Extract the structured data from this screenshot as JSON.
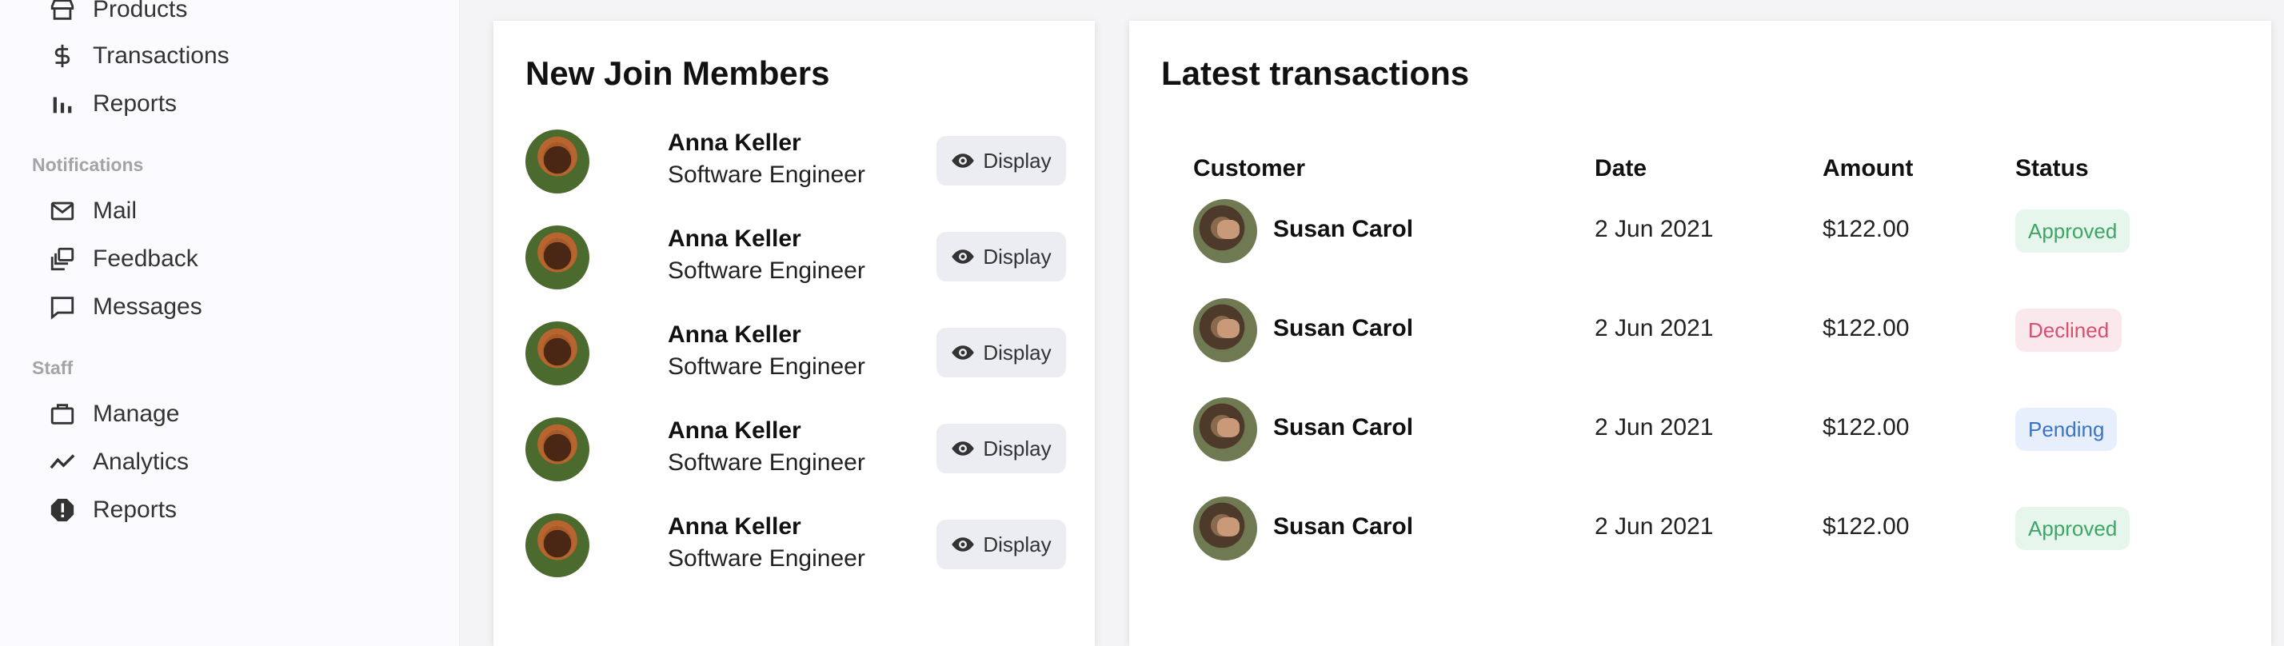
{
  "sidebar": {
    "items_top": [
      {
        "label": "Products",
        "icon": "store-icon"
      },
      {
        "label": "Transactions",
        "icon": "dollar-icon"
      },
      {
        "label": "Reports",
        "icon": "bar-chart-icon"
      }
    ],
    "notifications_title": "Notifications",
    "notifications_items": [
      {
        "label": "Mail",
        "icon": "mail-icon"
      },
      {
        "label": "Feedback",
        "icon": "feedback-icon"
      },
      {
        "label": "Messages",
        "icon": "message-icon"
      }
    ],
    "staff_title": "Staff",
    "staff_items": [
      {
        "label": "Manage",
        "icon": "briefcase-icon"
      },
      {
        "label": "Analytics",
        "icon": "trend-icon"
      },
      {
        "label": "Reports",
        "icon": "alert-icon"
      }
    ]
  },
  "members": {
    "title": "New Join Members",
    "button_label": "Display",
    "rows": [
      {
        "name": "Anna Keller",
        "role": "Software Engineer"
      },
      {
        "name": "Anna Keller",
        "role": "Software Engineer"
      },
      {
        "name": "Anna Keller",
        "role": "Software Engineer"
      },
      {
        "name": "Anna Keller",
        "role": "Software Engineer"
      },
      {
        "name": "Anna Keller",
        "role": "Software Engineer"
      }
    ]
  },
  "transactions": {
    "title": "Latest transactions",
    "columns": {
      "customer": "Customer",
      "date": "Date",
      "amount": "Amount",
      "status": "Status"
    },
    "rows": [
      {
        "customer": "Susan Carol",
        "date": "2 Jun 2021",
        "amount": "$122.00",
        "status": "Approved"
      },
      {
        "customer": "Susan Carol",
        "date": "2 Jun 2021",
        "amount": "$122.00",
        "status": "Declined"
      },
      {
        "customer": "Susan Carol",
        "date": "2 Jun 2021",
        "amount": "$122.00",
        "status": "Pending"
      },
      {
        "customer": "Susan Carol",
        "date": "2 Jun 2021",
        "amount": "$122.00",
        "status": "Approved"
      }
    ]
  },
  "colors": {
    "approved_text": "#3ea567",
    "approved_bg": "#e6f6ec",
    "declined_text": "#d4506e",
    "declined_bg": "#fbe8ec",
    "pending_text": "#3c73c6",
    "pending_bg": "#e6effb"
  }
}
